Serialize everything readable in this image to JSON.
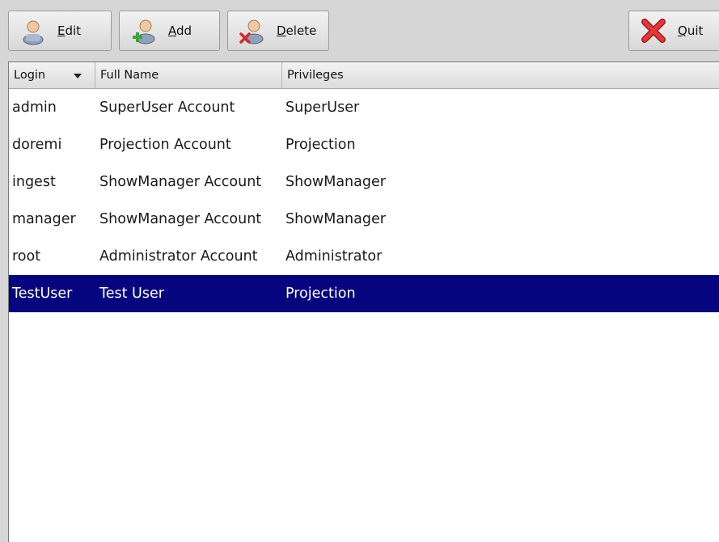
{
  "toolbar": {
    "edit": {
      "label_u": "E",
      "label_rest": "dit",
      "icon": "user-edit-icon"
    },
    "add": {
      "label_u": "A",
      "label_rest": "dd",
      "icon": "user-add-icon"
    },
    "delete": {
      "label_u": "D",
      "label_rest": "elete",
      "icon": "user-delete-icon"
    },
    "quit": {
      "label_u": "Q",
      "label_rest": "uit",
      "icon": "quit-x-icon"
    }
  },
  "table": {
    "columns": [
      {
        "label": "Login",
        "sorted": "descending"
      },
      {
        "label": "Full Name"
      },
      {
        "label": "Privileges"
      }
    ],
    "rows": [
      {
        "login": "admin",
        "full_name": "SuperUser Account",
        "privileges": "SuperUser",
        "selected": false
      },
      {
        "login": "doremi",
        "full_name": "Projection Account",
        "privileges": "Projection",
        "selected": false
      },
      {
        "login": "ingest",
        "full_name": "ShowManager Account",
        "privileges": "ShowManager",
        "selected": false
      },
      {
        "login": "manager",
        "full_name": "ShowManager Account",
        "privileges": "ShowManager",
        "selected": false
      },
      {
        "login": "root",
        "full_name": "Administrator Account",
        "privileges": "Administrator",
        "selected": false
      },
      {
        "login": "TestUser",
        "full_name": "Test User",
        "privileges": "Projection",
        "selected": true
      }
    ]
  },
  "colors": {
    "selection": "#05057f",
    "selection_text": "#ffffff",
    "window_bg": "#d6d6d6"
  }
}
